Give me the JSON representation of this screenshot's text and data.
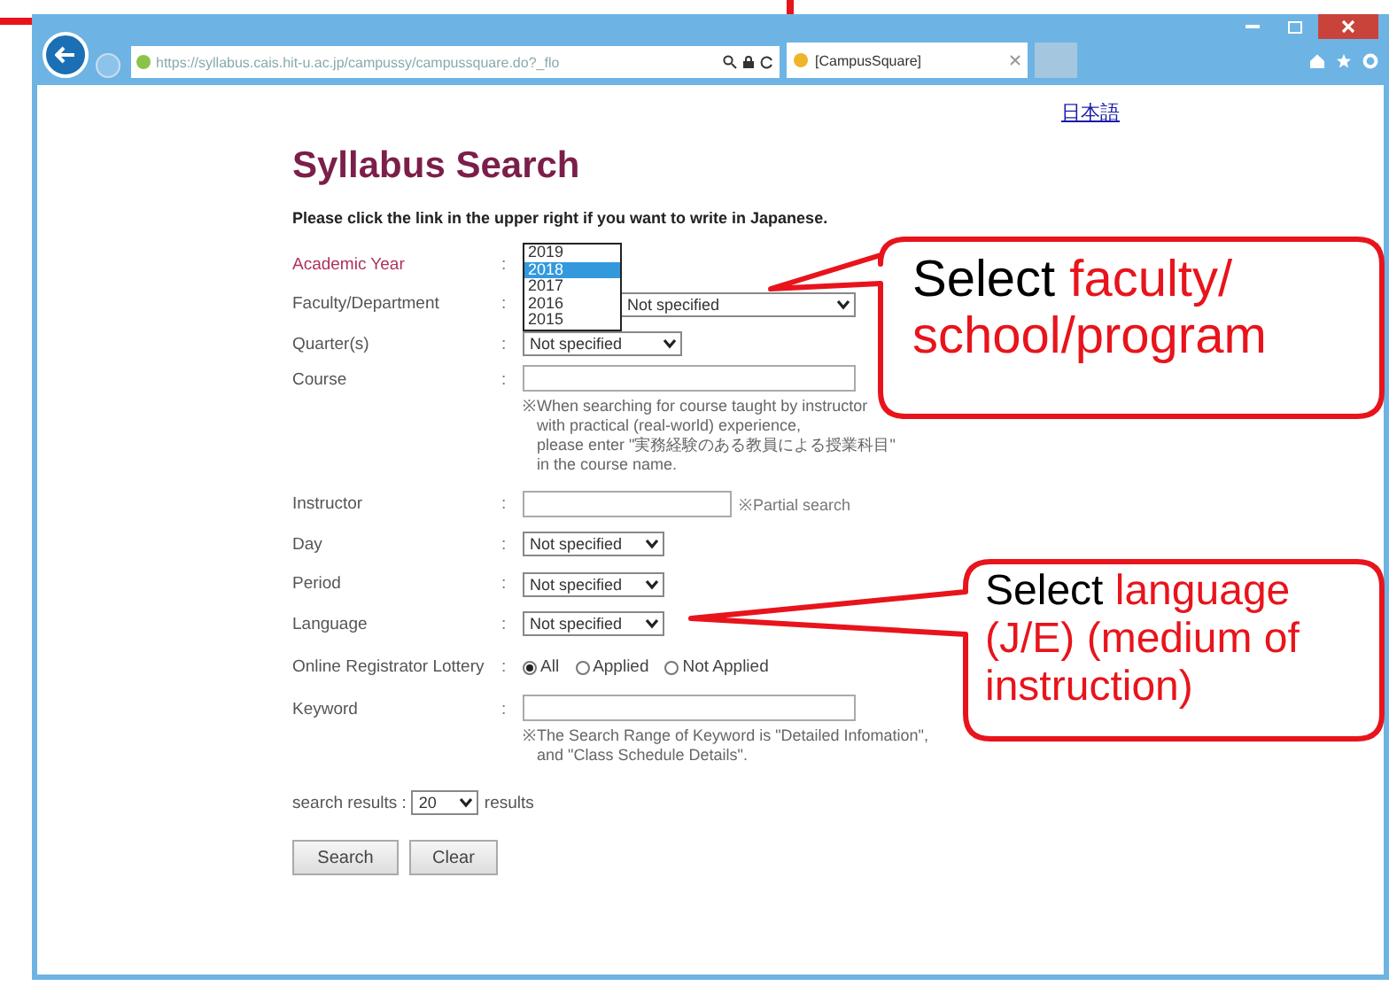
{
  "browser": {
    "url": "https://syllabus.cais.hit-u.ac.jp/campussy/campussquare.do?_flo",
    "tab_title": "[CampusSquare]"
  },
  "language_link": "日本語",
  "title": "Syllabus Search",
  "instruction": "Please click the link in the upper right if you want to write in Japanese.",
  "fields": [
    {
      "kind": "year",
      "label": "Academic Year",
      "colon": ":",
      "options": [
        {
          "label": "2019",
          "selected": false
        },
        {
          "label": "2018",
          "selected": true
        },
        {
          "label": "2017",
          "selected": false
        },
        {
          "label": "2016",
          "selected": false
        },
        {
          "label": "2015",
          "selected": false
        }
      ]
    },
    {
      "kind": "select",
      "label": "Faculty/Department",
      "colon": ":",
      "value": "Not specified"
    },
    {
      "kind": "select",
      "label": "Quarter(s)",
      "colon": ":",
      "value": "Not specified"
    },
    {
      "kind": "text",
      "label": "Course",
      "colon": ":",
      "note_lines": [
        "※When searching for course taught by instructor",
        "with practical (real-world) experience,",
        "please enter \"実務経験のある教員による授業科目\"",
        "in the course name."
      ]
    },
    {
      "kind": "text",
      "label": "Instructor",
      "colon": ":",
      "hint": "※Partial search"
    },
    {
      "kind": "select",
      "label": "Day",
      "colon": ":",
      "value": "Not specified"
    },
    {
      "kind": "select",
      "label": "Period",
      "colon": ":",
      "value": "Not specified"
    },
    {
      "kind": "select",
      "label": "Language",
      "colon": ":",
      "value": "Not specified"
    },
    {
      "kind": "radio",
      "label": "Online Registrator Lottery",
      "colon": ":",
      "options": [
        {
          "label": "All",
          "selected": true
        },
        {
          "label": "Applied",
          "selected": false
        },
        {
          "label": "Not Applied",
          "selected": false
        }
      ]
    },
    {
      "kind": "text",
      "label": "Keyword",
      "colon": ":",
      "note_lines": [
        "※The Search Range of Keyword is \"Detailed Infomation\",",
        "and \"Class Schedule Details\"."
      ]
    }
  ],
  "results": {
    "label": "search results :",
    "value": "20",
    "suffix": "results"
  },
  "buttons": [
    "Search",
    "Clear"
  ],
  "callouts": [
    {
      "lead": "Select",
      "highlight": "faculty/ school/program"
    },
    {
      "lead": "Select",
      "highlight": "language (J/E) (medium of instruction)"
    }
  ]
}
